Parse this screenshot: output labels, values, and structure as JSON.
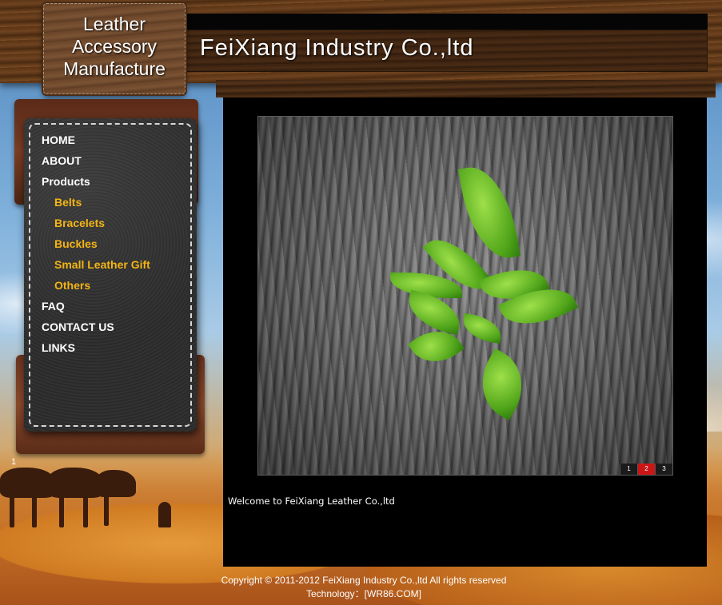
{
  "logo": {
    "line1": "Leather",
    "line2": "Accessory",
    "line3": "Manufacture"
  },
  "header": {
    "company_name": "FeiXiang Industry Co.,ltd"
  },
  "nav": {
    "items": [
      {
        "label": "HOME",
        "type": "main"
      },
      {
        "label": "ABOUT",
        "type": "main"
      },
      {
        "label": "Products",
        "type": "main"
      },
      {
        "label": "Belts",
        "type": "sub"
      },
      {
        "label": "Bracelets",
        "type": "sub"
      },
      {
        "label": "Buckles",
        "type": "sub"
      },
      {
        "label": "Small Leather Gift",
        "type": "sub"
      },
      {
        "label": "Others",
        "type": "sub"
      },
      {
        "label": "FAQ",
        "type": "main"
      },
      {
        "label": "CONTACT US",
        "type": "main"
      },
      {
        "label": "LINKS",
        "type": "main"
      }
    ],
    "sub_color": "#f3b515"
  },
  "side_number": "1",
  "slideshow": {
    "image_icon": "tree-leaf-photo",
    "pages": [
      "1",
      "2",
      "3"
    ],
    "active_page": 2,
    "active_color": "#cc1616"
  },
  "content": {
    "welcome_text": "Welcome to FeiXiang Leather Co.,ltd"
  },
  "footer": {
    "copyright": "Copyright © 2011-2012 FeiXiang Industry Co.,ltd All rights reserved",
    "technology": "Technology：[WR86.COM]"
  }
}
